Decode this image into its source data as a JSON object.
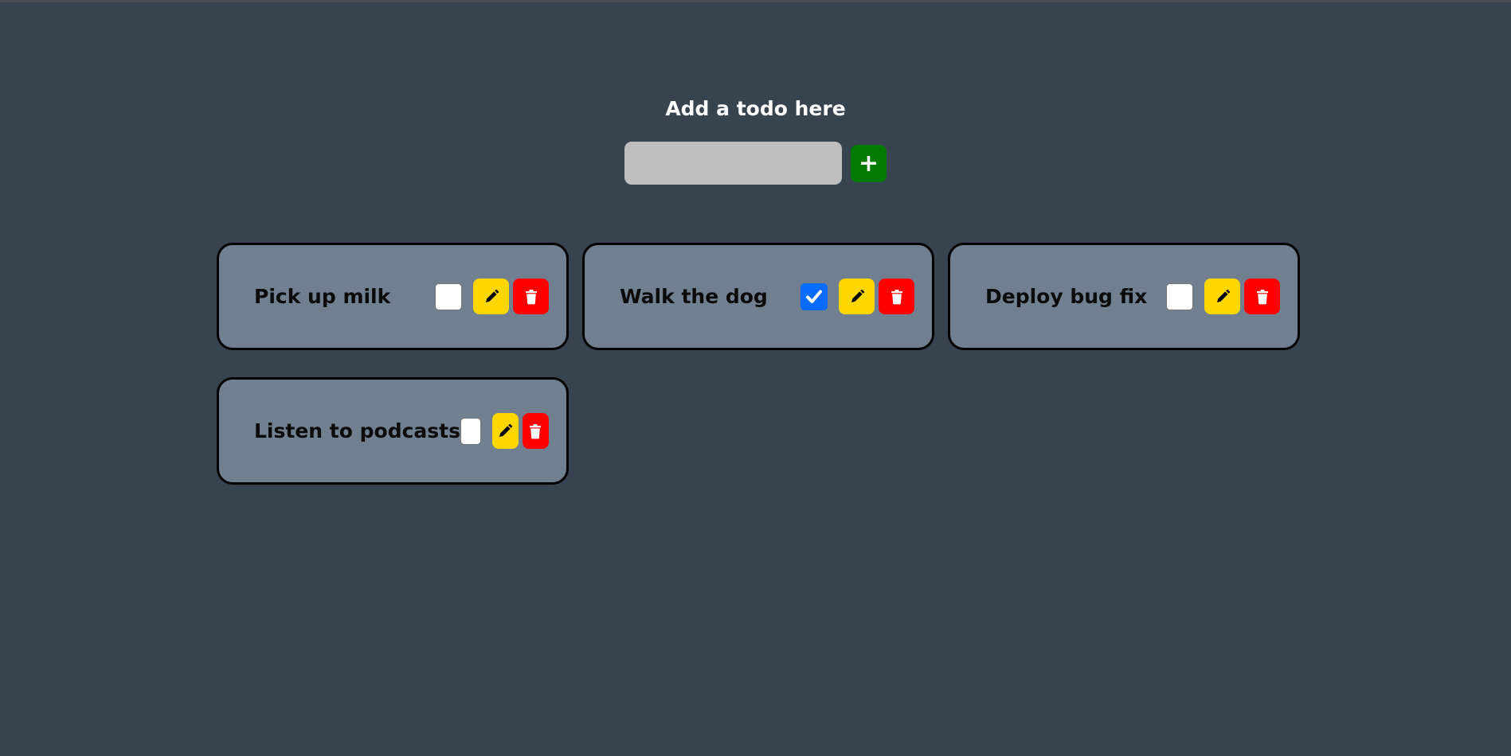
{
  "header": {
    "title": "Add a todo here"
  },
  "input": {
    "value": "",
    "placeholder": ""
  },
  "add_button": {
    "label": "+"
  },
  "todos": [
    {
      "text": "Pick up milk",
      "checked": false
    },
    {
      "text": "Walk the dog",
      "checked": true
    },
    {
      "text": "Deploy bug fix",
      "checked": false
    },
    {
      "text": "Listen to podcasts",
      "checked": false
    }
  ],
  "icons": {
    "edit": "pencil-icon",
    "delete": "trash-icon",
    "check": "checkmark-icon"
  },
  "colors": {
    "background": "#374450",
    "card": "#708090",
    "add": "#007a00",
    "edit": "#ffd700",
    "delete": "#ff0000",
    "checked": "#0a6cff"
  }
}
